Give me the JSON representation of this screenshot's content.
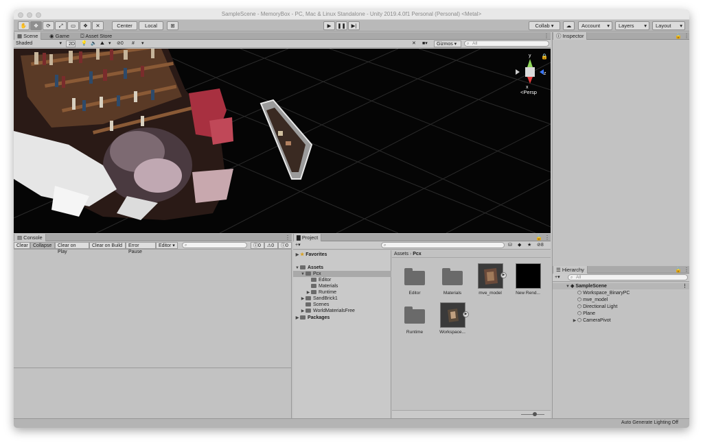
{
  "window": {
    "title": "SampleScene - MemoryBox - PC, Mac & Linux Standalone - Unity 2019.4.0f1 Personal (Personal) <Metal>"
  },
  "toolbar": {
    "pivot_mode": "Center",
    "pivot_space": "Local",
    "collab": "Collab ▾",
    "account": "Account",
    "layers": "Layers",
    "layout": "Layout"
  },
  "scene_panel": {
    "tabs": [
      "Scene",
      "Game",
      "Asset Store"
    ],
    "draw_mode": "Shaded",
    "mode_2d": "2D",
    "hidden_count": "0",
    "gizmos": "Gizmos",
    "search_placeholder": "All",
    "gizmo_axes": {
      "y": "y",
      "z": "z",
      "x": "x"
    },
    "projection": "<Persp"
  },
  "inspector": {
    "tab": "Inspector"
  },
  "console": {
    "tab": "Console",
    "buttons": [
      "Clear",
      "Collapse",
      "Clear on Play",
      "Clear on Build",
      "Error Pause",
      "Editor ▾"
    ],
    "counts": {
      "info": "0",
      "warn": "0",
      "error": "0"
    }
  },
  "project": {
    "tab": "Project",
    "hidden_count": "8",
    "favorites": "Favorites",
    "tree": [
      {
        "label": "Assets",
        "bold": true
      },
      {
        "label": "Pcx"
      },
      {
        "label": "Editor"
      },
      {
        "label": "Materials"
      },
      {
        "label": "Runtime"
      },
      {
        "label": "SandBrick1"
      },
      {
        "label": "Scenes"
      },
      {
        "label": "WorldMaterialsFree"
      },
      {
        "label": "Packages",
        "bold": true
      }
    ],
    "breadcrumb": {
      "root": "Assets",
      "current": "Pcx"
    },
    "assets": [
      {
        "label": "Editor",
        "kind": "folder"
      },
      {
        "label": "Materials",
        "kind": "folder"
      },
      {
        "label": "mve_model",
        "kind": "model"
      },
      {
        "label": "New Rend...",
        "kind": "render"
      },
      {
        "label": "Runtime",
        "kind": "folder"
      },
      {
        "label": "Workspace...",
        "kind": "model"
      }
    ]
  },
  "hierarchy": {
    "tab": "Hierarchy",
    "search_placeholder": "All",
    "scene": "SampleScene",
    "items": [
      "Workspace_BinaryPC",
      "mve_model",
      "Directional Light",
      "Plane",
      "CameraPivot"
    ]
  },
  "status": {
    "text": "Auto Generate Lighting Off"
  }
}
